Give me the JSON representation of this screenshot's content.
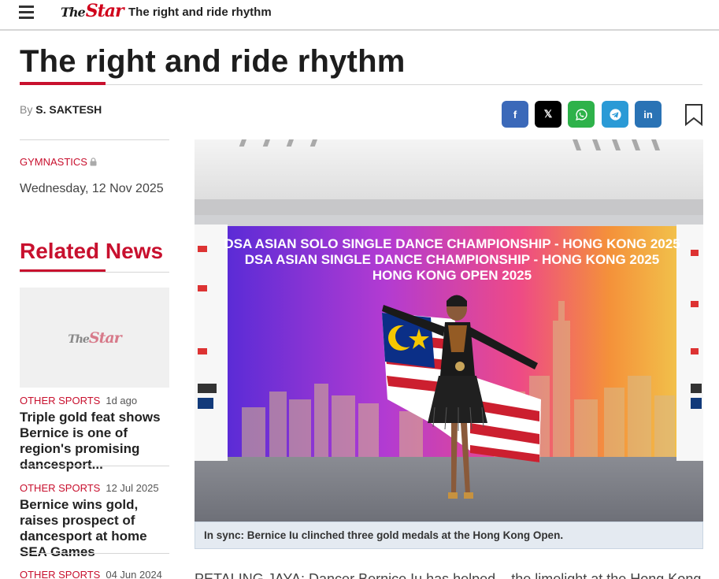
{
  "topbar": {
    "menu_icon": "hamburger-menu-icon",
    "logo_prefix": "The",
    "logo_main": "Star",
    "title": "The right and ride rhythm"
  },
  "article": {
    "headline": "The right and ride rhythm",
    "byline_prefix": "By",
    "author": "S. SAKTESH",
    "category": "GYMNASTICS",
    "date": "Wednesday, 12 Nov 2025",
    "caption": "In sync: Bernice Iu clinched three gold medals at the Hong Kong Open.",
    "body_start": "PETALING JAYA: Dancer Bernice Iu has helped... the limelight at the Hong Kong Open t"
  },
  "share": {
    "facebook": "f",
    "x": "𝕏",
    "whatsapp_icon": "whatsapp-icon",
    "telegram_icon": "telegram-icon",
    "linkedin": "in",
    "bookmark_icon": "bookmark-icon"
  },
  "banner": {
    "line1": "DSA ASIAN SOLO SINGLE DANCE CHAMPIONSHIP - HONG KONG 2025",
    "line2": "DSA ASIAN SINGLE DANCE CHAMPIONSHIP - HONG KONG 2025",
    "line3": "HONG KONG OPEN 2025"
  },
  "related": {
    "title": "Related News",
    "thumb_logo_prefix": "The",
    "thumb_logo_main": "Star",
    "items": [
      {
        "category": "OTHER SPORTS",
        "time": "1d ago",
        "headline": "Triple gold feat shows Bernice is one of region's promising dancesport..."
      },
      {
        "category": "OTHER SPORTS",
        "time": "12 Jul 2025",
        "headline": "Bernice wins gold, raises prospect of dancesport at home SEA Games"
      },
      {
        "category": "OTHER SPORTS",
        "time": "04 Jun 2024",
        "headline": ""
      }
    ]
  },
  "colors": {
    "brand_red": "#c8102e",
    "facebook": "#3b69b9",
    "whatsapp": "#2eb24a",
    "telegram": "#2a9ad6",
    "linkedin": "#2a73b5"
  }
}
